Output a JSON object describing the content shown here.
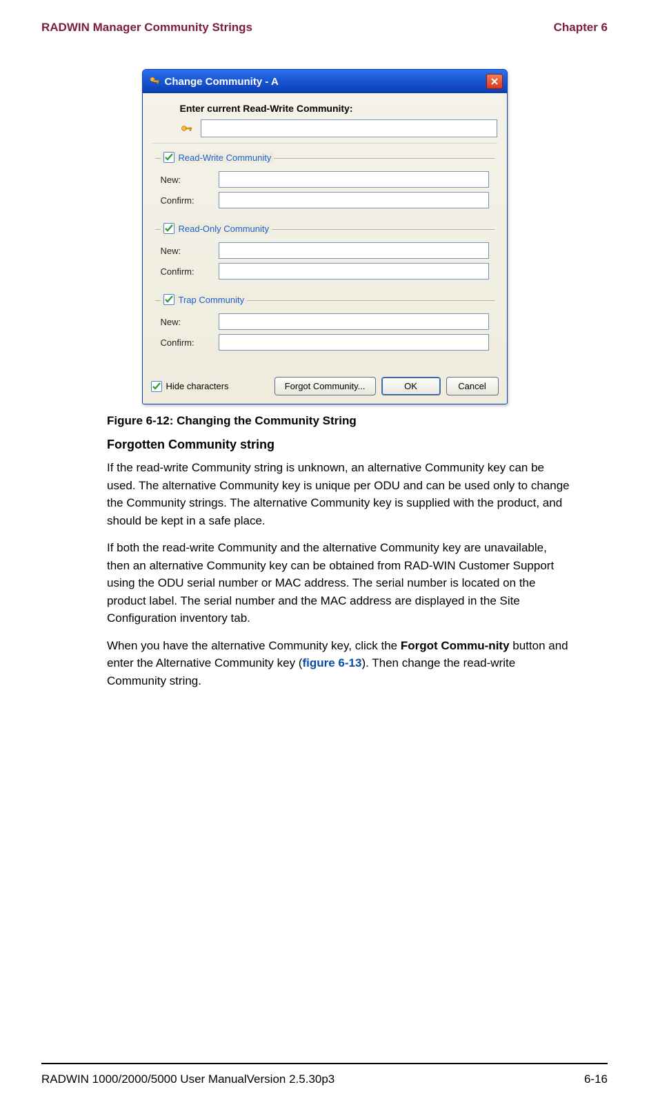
{
  "header": {
    "left": "RADWIN Manager Community Strings",
    "right": "Chapter 6"
  },
  "dialog": {
    "title": "Change Community - A",
    "prompt": "Enter current Read-Write Community:",
    "current_value": "",
    "groups": {
      "rw": {
        "legend": "Read-Write Community",
        "new_label": "New:",
        "confirm_label": "Confirm:",
        "new_value": "",
        "confirm_value": ""
      },
      "ro": {
        "legend": "Read-Only Community",
        "new_label": "New:",
        "confirm_label": "Confirm:",
        "new_value": "",
        "confirm_value": ""
      },
      "trap": {
        "legend": "Trap Community",
        "new_label": "New:",
        "confirm_label": "Confirm:",
        "new_value": "",
        "confirm_value": ""
      }
    },
    "hide_label": "Hide characters",
    "buttons": {
      "forgot": "Forgot Community...",
      "ok": "OK",
      "cancel": "Cancel"
    }
  },
  "figure_caption": "Figure 6-12: Changing the Community String",
  "sub_heading": "Forgotten Community string",
  "p1": "If the read-write Community string is unknown, an alternative Community key can be used. The alternative Community key is unique per ODU and can be used only to change the Community strings. The alternative Community key is supplied with the product, and should be kept in a safe place.",
  "p2": "If both the read-write Community and the alternative Community key are unavailable, then an alternative Community key can be obtained from RAD-WIN Customer Support using the ODU serial number or MAC address. The serial number is located on the product label. The serial number and the MAC address are displayed in the Site Configuration inventory tab.",
  "p3a": "When you have the alternative Community key, click the ",
  "p3b": "Forgot Commu-nity",
  "p3c": " button and enter the Alternative Community key (",
  "p3d": "figure 6-13",
  "p3e": "). Then change the read-write Community string.",
  "footer": {
    "left": "RADWIN 1000/2000/5000 User ManualVersion  2.5.30p3",
    "right": "6-16"
  }
}
